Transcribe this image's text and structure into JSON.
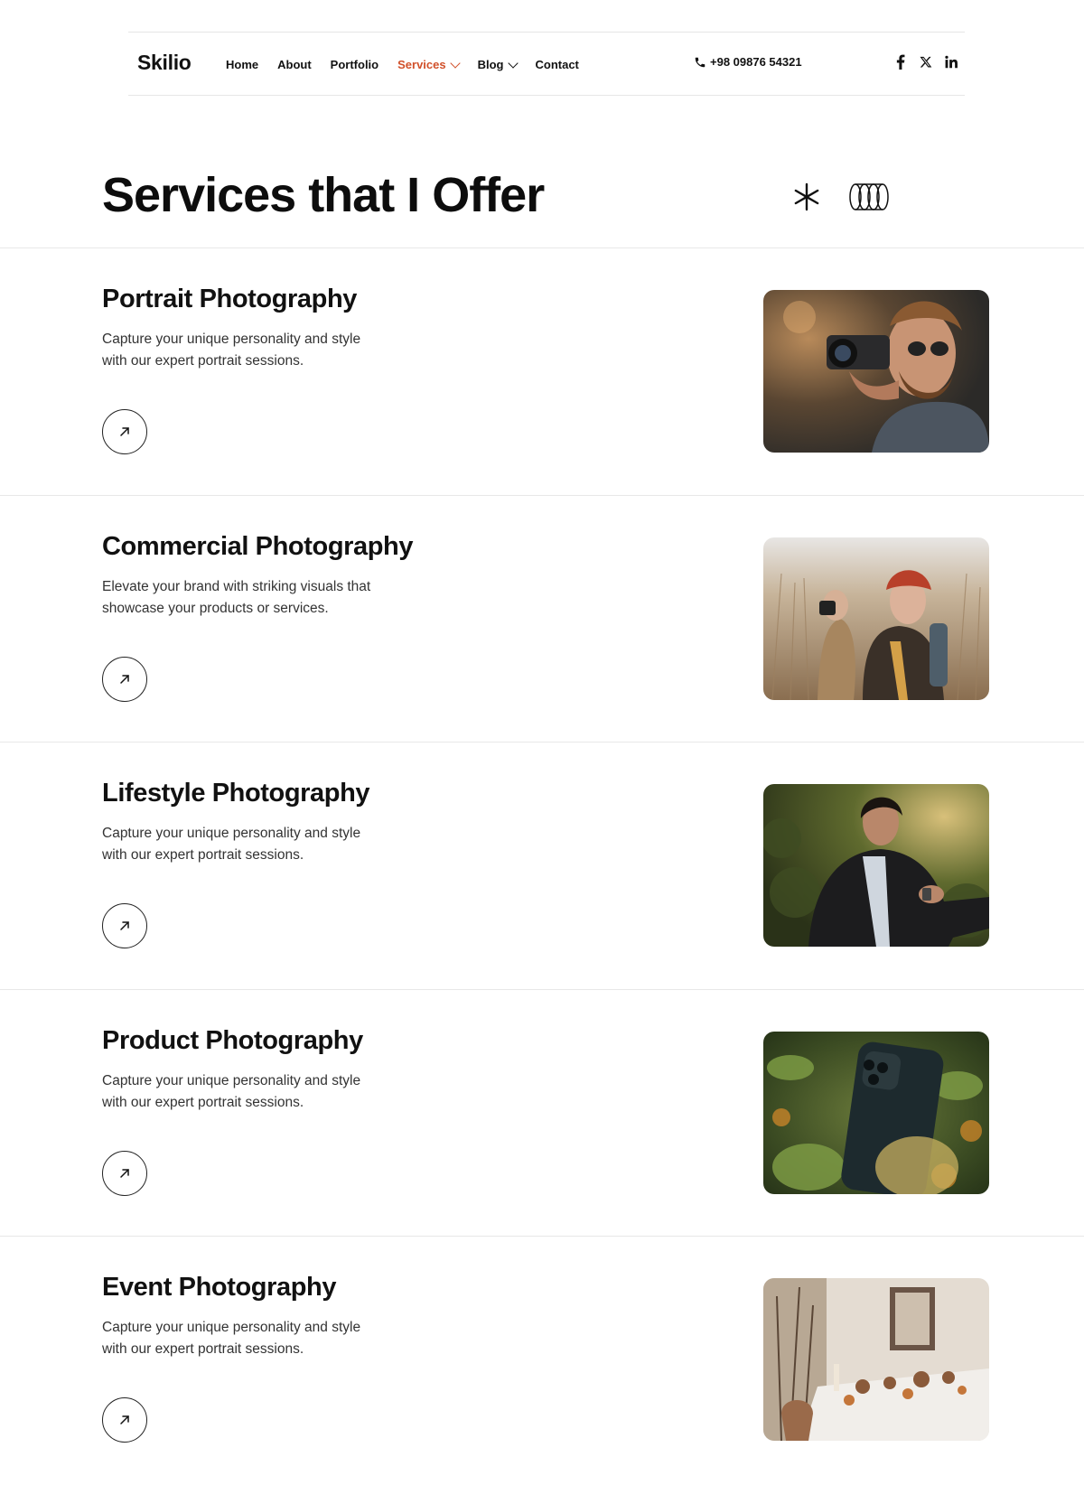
{
  "header": {
    "logo": "Skilio",
    "menu": [
      {
        "label": "Home",
        "active": false,
        "dropdown": false
      },
      {
        "label": "About",
        "active": false,
        "dropdown": false
      },
      {
        "label": "Portfolio",
        "active": false,
        "dropdown": false
      },
      {
        "label": "Services",
        "active": true,
        "dropdown": true
      },
      {
        "label": "Blog",
        "active": false,
        "dropdown": true
      },
      {
        "label": "Contact",
        "active": false,
        "dropdown": false
      }
    ],
    "phone": "+98 09876 54321",
    "socials": [
      "facebook-icon",
      "x-icon",
      "linkedin-icon"
    ]
  },
  "page": {
    "title": "Services that I Offer"
  },
  "services": [
    {
      "title": "Portrait Photography",
      "desc_line1": "Capture your unique personality and style",
      "desc_line2": "with our expert portrait sessions.",
      "image": "photographer-with-camera"
    },
    {
      "title": "Commercial Photography",
      "desc_line1": "Elevate your brand with striking visuals that",
      "desc_line2": "showcase your products or services.",
      "image": "couple-in-wheat-field"
    },
    {
      "title": "Lifestyle Photography",
      "desc_line1": "Capture your unique personality and style",
      "desc_line2": "with our expert portrait sessions.",
      "image": "man-checking-watch"
    },
    {
      "title": "Product Photography",
      "desc_line1": "Capture your unique personality and style",
      "desc_line2": "with our expert portrait sessions.",
      "image": "phone-in-foliage"
    },
    {
      "title": "Event Photography",
      "desc_line1": "Capture your unique personality and style",
      "desc_line2": "with our expert portrait sessions.",
      "image": "event-table-setting"
    }
  ],
  "colors": {
    "accent": "#d1502a",
    "text": "#111111",
    "divider": "#e8e8e8"
  }
}
